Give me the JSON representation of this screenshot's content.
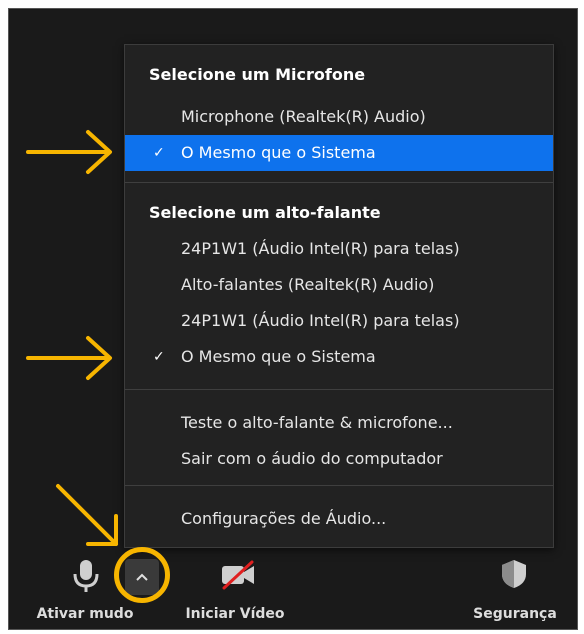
{
  "microphone_section": {
    "header": "Selecione um Microfone",
    "items": [
      {
        "label": "Microphone (Realtek(R) Audio)",
        "checked": false,
        "selected": false
      },
      {
        "label": "O Mesmo que o Sistema",
        "checked": true,
        "selected": true
      }
    ]
  },
  "speaker_section": {
    "header": "Selecione um alto-falante",
    "items": [
      {
        "label": "24P1W1 (Áudio Intel(R) para telas)",
        "checked": false
      },
      {
        "label": "Alto-falantes (Realtek(R) Audio)",
        "checked": false
      },
      {
        "label": "24P1W1 (Áudio Intel(R) para telas)",
        "checked": false
      },
      {
        "label": "O Mesmo que o Sistema",
        "checked": true
      }
    ]
  },
  "actions": {
    "test": "Teste o alto-falante & microfone...",
    "leave_audio": "Sair com o áudio do computador",
    "settings": "Configurações de Áudio..."
  },
  "toolbar": {
    "mute_label": "Ativar mudo",
    "video_label": "Iniciar Vídeo",
    "security_label": "Segurança",
    "checkmark": "✓"
  },
  "colors": {
    "accent": "#0e72ed",
    "annotation": "#f7b500",
    "menu_bg": "#222222"
  },
  "icons": [
    "microphone-icon",
    "caret-up-icon",
    "video-off-icon",
    "shield-icon",
    "arrow-annotation-icon"
  ]
}
